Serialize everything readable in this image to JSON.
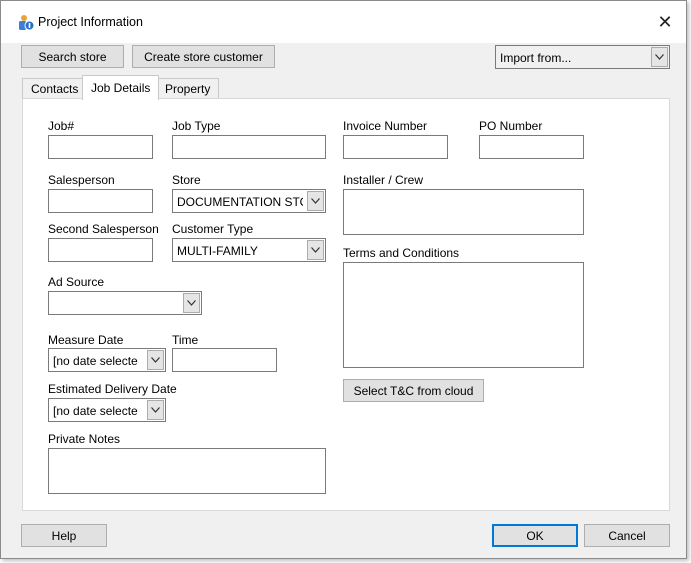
{
  "window": {
    "title": "Project Information"
  },
  "toolbar": {
    "search_store": "Search store",
    "create_store_customer": "Create store customer",
    "import_from": "Import from..."
  },
  "tabs": [
    "Contacts",
    "Job Details",
    "Property"
  ],
  "form": {
    "job_label": "Job#",
    "job_type_label": "Job Type",
    "invoice_number_label": "Invoice Number",
    "po_number_label": "PO Number",
    "salesperson_label": "Salesperson",
    "store_label": "Store",
    "store_value": "DOCUMENTATION STO",
    "installer_label": "Installer / Crew",
    "second_salesperson_label": "Second Salesperson",
    "customer_type_label": "Customer Type",
    "customer_type_value": "MULTI-FAMILY",
    "terms_label": "Terms and Conditions",
    "ad_source_label": "Ad Source",
    "measure_date_label": "Measure Date",
    "measure_date_value": "[no date selecte",
    "time_label": "Time",
    "est_delivery_label": "Estimated Delivery Date",
    "est_delivery_value": "[no date selecte",
    "private_notes_label": "Private Notes",
    "select_tc_button": "Select T&C from cloud"
  },
  "footer": {
    "help": "Help",
    "ok": "OK",
    "cancel": "Cancel"
  },
  "icons": {
    "app": "app-icon",
    "close": "close-icon",
    "dropdown": "chevron-down-icon"
  },
  "colors": {
    "accent": "#0078d7"
  }
}
